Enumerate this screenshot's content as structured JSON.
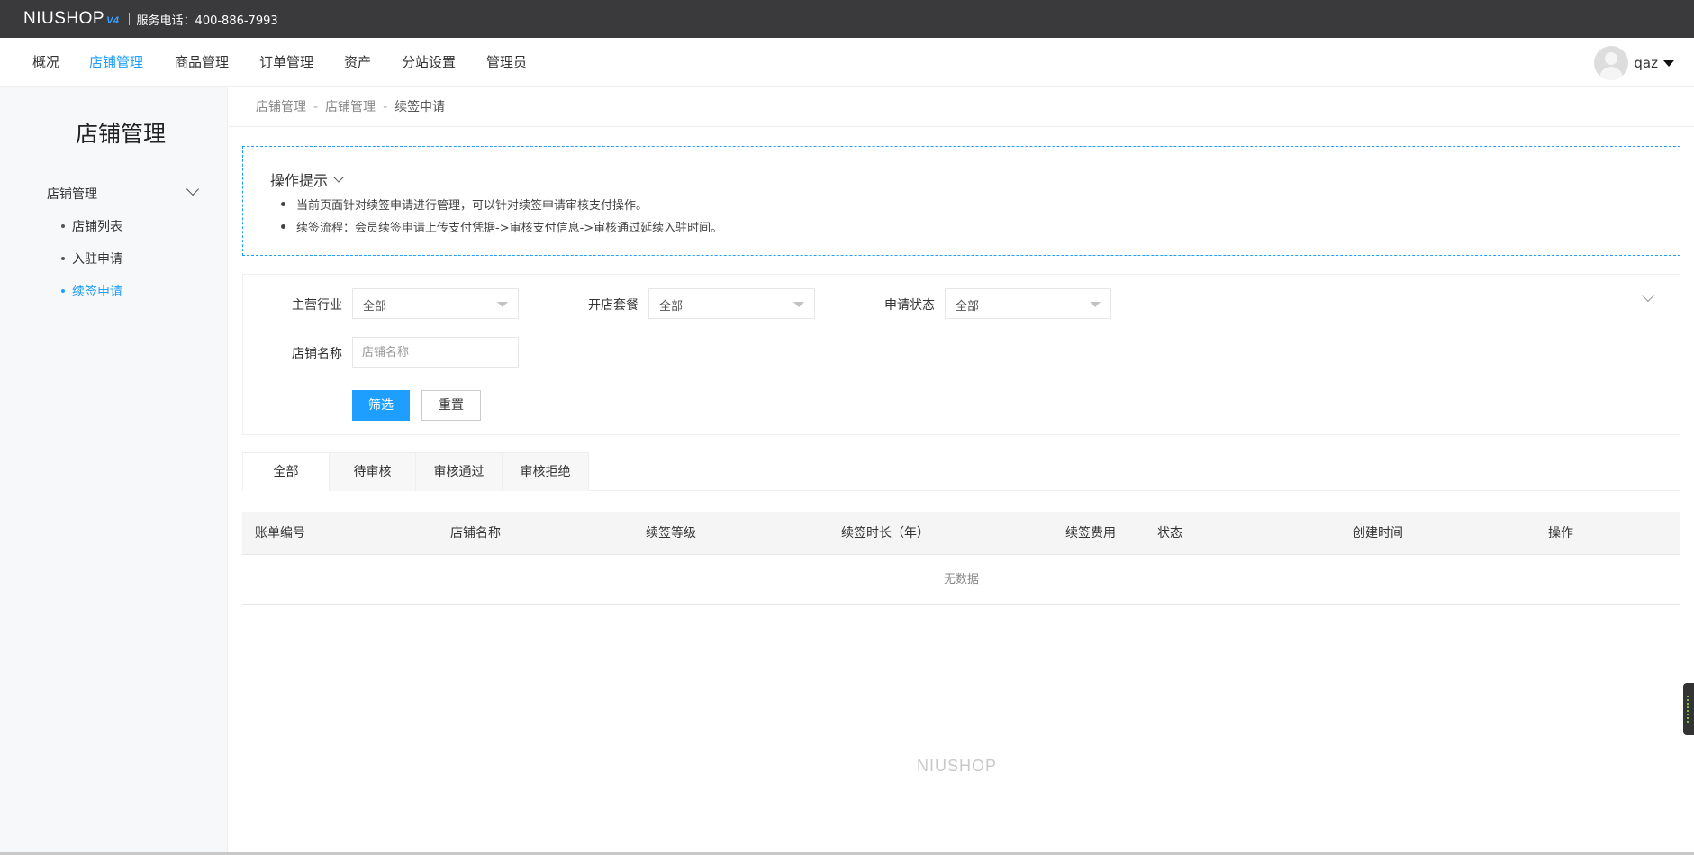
{
  "topbar": {
    "logo": "NIUSHOP",
    "logo_version": "V4",
    "hotline": "服务电话：400-886-7993"
  },
  "nav": {
    "items": [
      {
        "label": "概况",
        "active": false
      },
      {
        "label": "店铺管理",
        "active": true
      },
      {
        "label": "商品管理",
        "active": false
      },
      {
        "label": "订单管理",
        "active": false
      },
      {
        "label": "资产",
        "active": false
      },
      {
        "label": "分站设置",
        "active": false
      },
      {
        "label": "管理员",
        "active": false
      }
    ],
    "username": "qaz"
  },
  "sidebar": {
    "title": "店铺管理",
    "group_label": "店铺管理",
    "items": [
      {
        "label": "店铺列表",
        "active": false
      },
      {
        "label": "入驻申请",
        "active": false
      },
      {
        "label": "续签申请",
        "active": true
      }
    ]
  },
  "breadcrumb": [
    "店铺管理",
    "店铺管理",
    "续签申请"
  ],
  "breadcrumb_sep": "-",
  "tips": {
    "title": "操作提示",
    "lines": [
      "当前页面针对续签申请进行管理，可以针对续签申请审核支付操作。",
      "续签流程：会员续签申请上传支付凭据->审核支付信息->审核通过延续入驻时间。"
    ]
  },
  "filters": {
    "industry_label": "主营行业",
    "industry_value": "全部",
    "package_label": "开店套餐",
    "package_value": "全部",
    "status_label": "申请状态",
    "status_value": "全部",
    "shop_name_label": "店铺名称",
    "shop_name_placeholder": "店铺名称",
    "shop_name_value": "",
    "filter_button": "筛选",
    "reset_button": "重置"
  },
  "tabs": [
    {
      "label": "全部",
      "active": true
    },
    {
      "label": "待审核",
      "active": false
    },
    {
      "label": "审核通过",
      "active": false
    },
    {
      "label": "审核拒绝",
      "active": false
    }
  ],
  "table": {
    "columns": [
      "账单编号",
      "店铺名称",
      "续签等级",
      "续签时长（年）",
      "续签费用",
      "状态",
      "创建时间",
      "操作"
    ],
    "empty_text": "无数据"
  },
  "footer_logo": "NIUSHOP",
  "colors": {
    "accent": "#1e9fff",
    "topbar": "#3a3a3c"
  }
}
